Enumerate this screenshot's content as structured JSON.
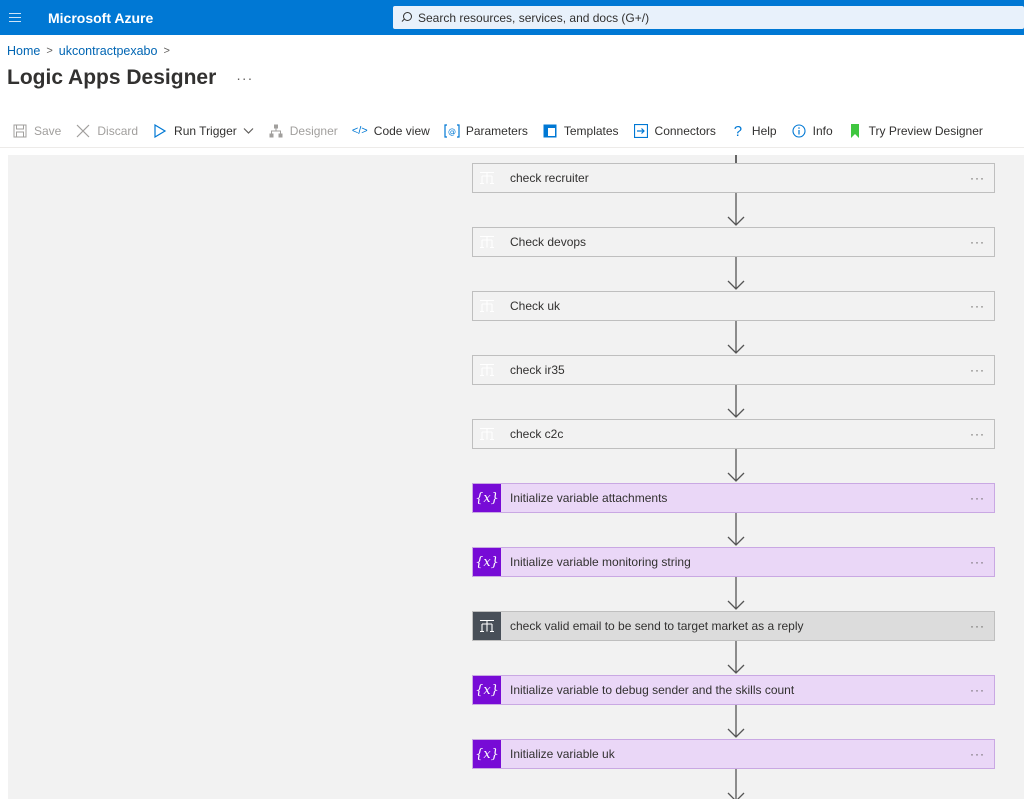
{
  "header": {
    "brand": "Microsoft Azure",
    "search_placeholder": "Search resources, services, and docs (G+/)"
  },
  "breadcrumb": {
    "home": "Home",
    "resource": "ukcontractpexabo"
  },
  "page": {
    "title": "Logic Apps Designer",
    "more": "···"
  },
  "toolbar": {
    "save": "Save",
    "discard": "Discard",
    "run_trigger": "Run Trigger",
    "designer": "Designer",
    "code_view": "Code view",
    "parameters": "Parameters",
    "templates": "Templates",
    "connectors": "Connectors",
    "help": "Help",
    "info": "Info",
    "try_preview": "Try Preview Designer"
  },
  "colors": {
    "azure_blue": "#0078d4",
    "control_icon": "#484f58",
    "variable_icon": "#770bd6",
    "variable_bg": "#ead7f7"
  },
  "steps": [
    {
      "type": "control",
      "icon": "condition-icon",
      "label": "check recruiter"
    },
    {
      "type": "control",
      "icon": "condition-icon",
      "label": "Check devops"
    },
    {
      "type": "control",
      "icon": "condition-icon",
      "label": "Check uk"
    },
    {
      "type": "control",
      "icon": "condition-icon",
      "label": "check ir35"
    },
    {
      "type": "control",
      "icon": "condition-icon",
      "label": "check c2c"
    },
    {
      "type": "variable",
      "icon": "variable-icon",
      "label": "Initialize variable attachments"
    },
    {
      "type": "variable",
      "icon": "variable-icon",
      "label": "Initialize variable monitoring string"
    },
    {
      "type": "control",
      "icon": "condition-icon",
      "label": "check valid email to be send to target market as a reply"
    },
    {
      "type": "variable",
      "icon": "variable-icon",
      "label": "Initialize variable to debug sender and the skills count"
    },
    {
      "type": "variable",
      "icon": "variable-icon",
      "label": "Initialize variable uk"
    }
  ],
  "step_more": "···"
}
